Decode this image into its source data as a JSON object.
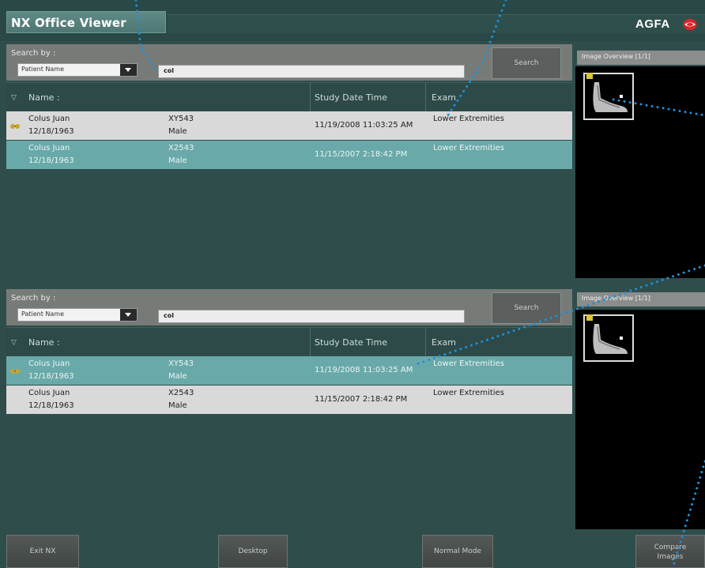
{
  "app": {
    "title": "NX Office Viewer",
    "brand": "AGFA"
  },
  "panes": [
    {
      "search_label": "Search by :",
      "select_value": "Patient Name",
      "search_value": "col",
      "search_button": "Search",
      "headers": {
        "name": "Name :",
        "study": "Study Date Time",
        "exam": "Exam"
      },
      "rows": [
        {
          "name": "Colus Juan",
          "dob": "12/18/1963",
          "id": "XY543",
          "sex": "Male",
          "study": "11/19/2008 11:03:25 AM",
          "exam": "Lower Extremities"
        },
        {
          "name": "Colus Juan",
          "dob": "12/18/1963",
          "id": "X2543",
          "sex": "Male",
          "study": "11/15/2007 2:18:42 PM",
          "exam": "Lower Extremities"
        }
      ],
      "overview": "Image Overview [1/1]"
    },
    {
      "search_label": "Search by :",
      "select_value": "Patient Name",
      "search_value": "col",
      "search_button": "Search",
      "headers": {
        "name": "Name :",
        "study": "Study Date Time",
        "exam": "Exam"
      },
      "rows": [
        {
          "name": "Colus Juan",
          "dob": "12/18/1963",
          "id": "XY543",
          "sex": "Male",
          "study": "11/19/2008 11:03:25 AM",
          "exam": "Lower Extremities"
        },
        {
          "name": "Colus Juan",
          "dob": "12/18/1963",
          "id": "X2543",
          "sex": "Male",
          "study": "11/15/2007 2:18:42 PM",
          "exam": "Lower Extremities"
        }
      ],
      "overview": "Image Overview [1/1]"
    }
  ],
  "buttons": {
    "exit": "Exit NX",
    "desktop": "Desktop",
    "normal": "Normal Mode",
    "compare_line1": "Compare",
    "compare_line2": "Images"
  },
  "colors": {
    "background": "#2f4d4b",
    "row_selected": "#6aa9a9",
    "row_normal": "#d9d9d9",
    "brand_red": "#d9262a"
  }
}
